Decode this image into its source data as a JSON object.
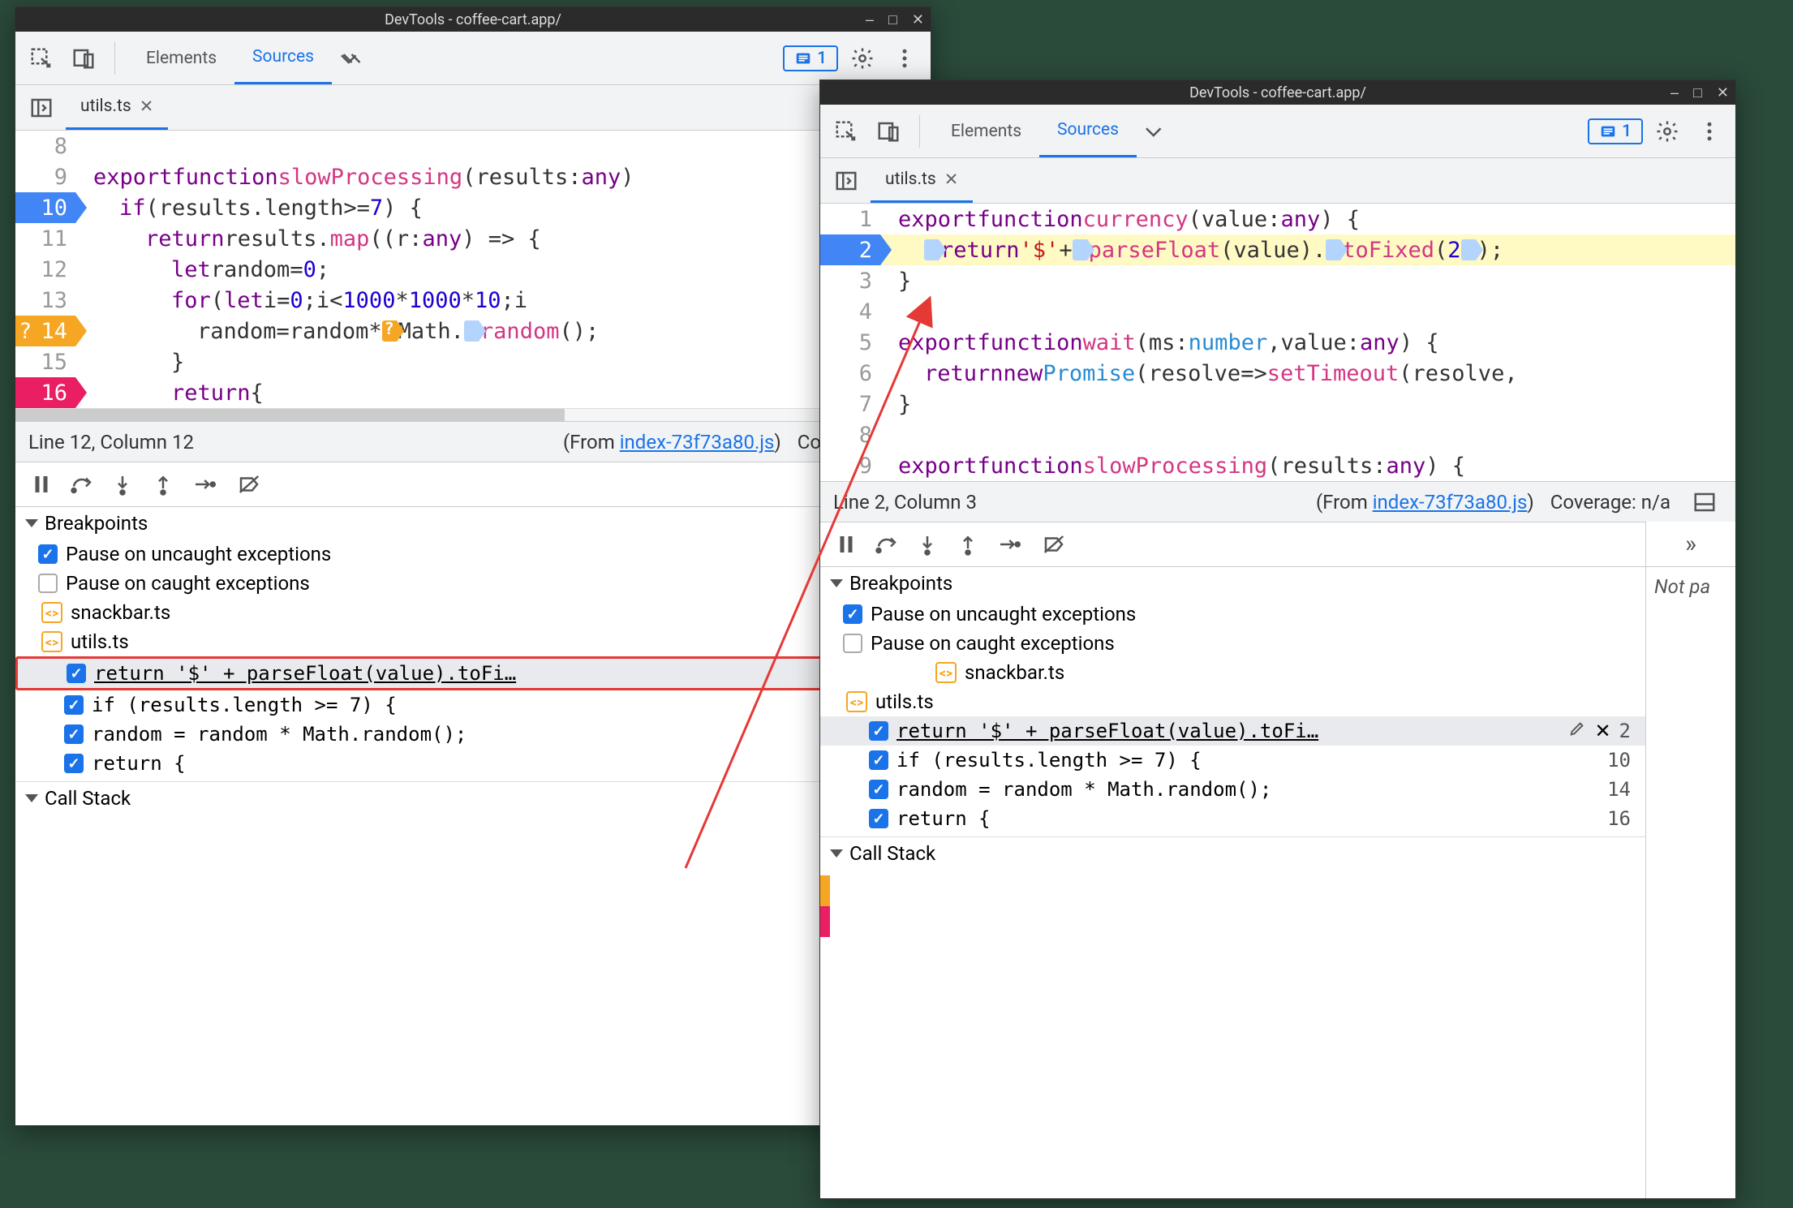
{
  "title": "DevTools - coffee-cart.app/",
  "toolbar": {
    "tabs": [
      "Elements",
      "Sources"
    ],
    "active": 1,
    "issues_count": "1"
  },
  "file_tab": "utils.ts",
  "win1": {
    "code": [
      {
        "n": "8",
        "cls": "",
        "html": ""
      },
      {
        "n": "9",
        "cls": "",
        "tokens": [
          [
            "kw",
            "export"
          ],
          [
            "pn",
            " "
          ],
          [
            "kw",
            "function"
          ],
          [
            "pn",
            " "
          ],
          [
            "fn",
            "slowProcessing"
          ],
          [
            "pn",
            "("
          ],
          [
            "id",
            "results"
          ],
          [
            "pn",
            ": "
          ],
          [
            "kw",
            "any"
          ],
          [
            "pn",
            ")"
          ]
        ]
      },
      {
        "n": "10",
        "cls": "bp-blue",
        "indent": 2,
        "tokens": [
          [
            "kw",
            "if"
          ],
          [
            "pn",
            " ("
          ],
          [
            "id",
            "results"
          ],
          [
            "pn",
            "."
          ],
          [
            "id",
            "length"
          ],
          [
            "pn",
            " >= "
          ],
          [
            "num",
            "7"
          ],
          [
            "pn",
            ") {"
          ]
        ]
      },
      {
        "n": "11",
        "cls": "",
        "indent": 4,
        "tokens": [
          [
            "kw",
            "return"
          ],
          [
            "pn",
            " "
          ],
          [
            "id",
            "results"
          ],
          [
            "pn",
            "."
          ],
          [
            "fn",
            "map"
          ],
          [
            "pn",
            "(("
          ],
          [
            "id",
            "r"
          ],
          [
            "pn",
            ": "
          ],
          [
            "kw",
            "any"
          ],
          [
            "pn",
            ") => {"
          ]
        ]
      },
      {
        "n": "12",
        "cls": "",
        "indent": 6,
        "tokens": [
          [
            "kw",
            "let"
          ],
          [
            "pn",
            " "
          ],
          [
            "id",
            "random"
          ],
          [
            "pn",
            " = "
          ],
          [
            "num",
            "0"
          ],
          [
            "pn",
            ";"
          ]
        ]
      },
      {
        "n": "13",
        "cls": "",
        "indent": 6,
        "tokens": [
          [
            "kw",
            "for"
          ],
          [
            "pn",
            " ("
          ],
          [
            "kw",
            "let"
          ],
          [
            "pn",
            " "
          ],
          [
            "id",
            "i"
          ],
          [
            "pn",
            " = "
          ],
          [
            "num",
            "0"
          ],
          [
            "pn",
            "; "
          ],
          [
            "id",
            "i"
          ],
          [
            "pn",
            " < "
          ],
          [
            "num",
            "1000"
          ],
          [
            "pn",
            " * "
          ],
          [
            "num",
            "1000"
          ],
          [
            "pn",
            " * "
          ],
          [
            "num",
            "10"
          ],
          [
            "pn",
            "; "
          ],
          [
            "id",
            "i"
          ]
        ]
      },
      {
        "n": "14",
        "cls": "bp-orange",
        "indent": 8,
        "tokens": [
          [
            "id",
            "random"
          ],
          [
            "pn",
            " = "
          ],
          [
            "id",
            "random"
          ],
          [
            "pn",
            " * "
          ],
          [
            "mkO",
            ""
          ],
          [
            "id",
            "Math"
          ],
          [
            "pn",
            "."
          ],
          [
            "mk",
            ""
          ],
          [
            "fn",
            "random"
          ],
          [
            "pn",
            "();"
          ]
        ]
      },
      {
        "n": "15",
        "cls": "",
        "indent": 6,
        "tokens": [
          [
            "pn",
            "}"
          ]
        ]
      },
      {
        "n": "16",
        "cls": "bp-pink",
        "indent": 6,
        "tokens": [
          [
            "kw",
            "return"
          ],
          [
            "pn",
            " {"
          ]
        ]
      }
    ],
    "status": {
      "pos": "Line 12, Column 12",
      "from_label": "(From ",
      "from_link": "index-73f73a80.js",
      "from_suffix": ")",
      "cov": "Coverage: n/a"
    }
  },
  "win2": {
    "code": [
      {
        "n": "1",
        "cls": "",
        "tokens": [
          [
            "kw",
            "export"
          ],
          [
            "pn",
            " "
          ],
          [
            "kw",
            "function"
          ],
          [
            "pn",
            " "
          ],
          [
            "fn",
            "currency"
          ],
          [
            "pn",
            "("
          ],
          [
            "id",
            "value"
          ],
          [
            "pn",
            ": "
          ],
          [
            "kw",
            "any"
          ],
          [
            "pn",
            ") {"
          ]
        ]
      },
      {
        "n": "2",
        "cls": "bp-blue",
        "hl": true,
        "indent": 2,
        "tokens": [
          [
            "mk",
            ""
          ],
          [
            "kw",
            "return"
          ],
          [
            "pn",
            " "
          ],
          [
            "str",
            "'$'"
          ],
          [
            "pn",
            " + "
          ],
          [
            "mk",
            ""
          ],
          [
            "fn",
            "parseFloat"
          ],
          [
            "pn",
            "("
          ],
          [
            "id",
            "value"
          ],
          [
            "pn",
            ")"
          ],
          [
            "pn",
            "."
          ],
          [
            "mk",
            ""
          ],
          [
            "fn",
            "toFixed"
          ],
          [
            "pn",
            "("
          ],
          [
            "num",
            "2"
          ],
          [
            "mk",
            ""
          ],
          [
            "pn",
            ");"
          ]
        ]
      },
      {
        "n": "3",
        "cls": "",
        "tokens": [
          [
            "pn",
            "}"
          ]
        ]
      },
      {
        "n": "4",
        "cls": "",
        "tokens": []
      },
      {
        "n": "5",
        "cls": "",
        "tokens": [
          [
            "kw",
            "export"
          ],
          [
            "pn",
            " "
          ],
          [
            "kw",
            "function"
          ],
          [
            "pn",
            " "
          ],
          [
            "fn",
            "wait"
          ],
          [
            "pn",
            "("
          ],
          [
            "id",
            "ms"
          ],
          [
            "pn",
            ": "
          ],
          [
            "ty",
            "number"
          ],
          [
            "pn",
            ", "
          ],
          [
            "id",
            "value"
          ],
          [
            "pn",
            ": "
          ],
          [
            "kw",
            "any"
          ],
          [
            "pn",
            ") {"
          ]
        ]
      },
      {
        "n": "6",
        "cls": "",
        "indent": 2,
        "tokens": [
          [
            "kw",
            "return"
          ],
          [
            "pn",
            " "
          ],
          [
            "kw",
            "new"
          ],
          [
            "pn",
            " "
          ],
          [
            "ty",
            "Promise"
          ],
          [
            "pn",
            "("
          ],
          [
            "id",
            "resolve"
          ],
          [
            "pn",
            " => "
          ],
          [
            "fn",
            "setTimeout"
          ],
          [
            "pn",
            "("
          ],
          [
            "id",
            "resolve"
          ],
          [
            "pn",
            ","
          ]
        ]
      },
      {
        "n": "7",
        "cls": "",
        "tokens": [
          [
            "pn",
            "}"
          ]
        ]
      },
      {
        "n": "8",
        "cls": "",
        "tokens": []
      },
      {
        "n": "9",
        "cls": "",
        "tokens": [
          [
            "kw",
            "export"
          ],
          [
            "pn",
            " "
          ],
          [
            "kw",
            "function"
          ],
          [
            "pn",
            " "
          ],
          [
            "fn",
            "slowProcessing"
          ],
          [
            "pn",
            "("
          ],
          [
            "id",
            "results"
          ],
          [
            "pn",
            ": "
          ],
          [
            "kw",
            "any"
          ],
          [
            "pn",
            ") {"
          ]
        ]
      }
    ],
    "status": {
      "pos": "Line 2, Column 3",
      "from_label": "(From ",
      "from_link": "index-73f73a80.js",
      "from_suffix": ")",
      "cov": "Coverage: n/a"
    },
    "right_panel": "Not pa"
  },
  "sections": {
    "breakpoints": "Breakpoints",
    "pause_uncaught": "Pause on uncaught exceptions",
    "pause_caught": "Pause on caught exceptions",
    "snackbar": "snackbar.ts",
    "utils": "utils.ts",
    "callstack": "Call Stack"
  },
  "bp_list": [
    {
      "text": "return '$' + parseFloat(value).toFi…",
      "count": "2",
      "sel": true
    },
    {
      "text": "if (results.length >= 7) {",
      "count": "10"
    },
    {
      "text": "random = random * Math.random();",
      "count": "14"
    },
    {
      "text": "return {",
      "count": "16"
    }
  ],
  "bp_list2": [
    {
      "text": "return '$' + parseFloat(value).toFi…",
      "count": "2",
      "sel": true
    },
    {
      "text": "if (results.length >= 7) {",
      "count": "10"
    },
    {
      "text": "random = random * Math.random();",
      "count": "14"
    },
    {
      "text": "return {",
      "count": "16"
    }
  ]
}
